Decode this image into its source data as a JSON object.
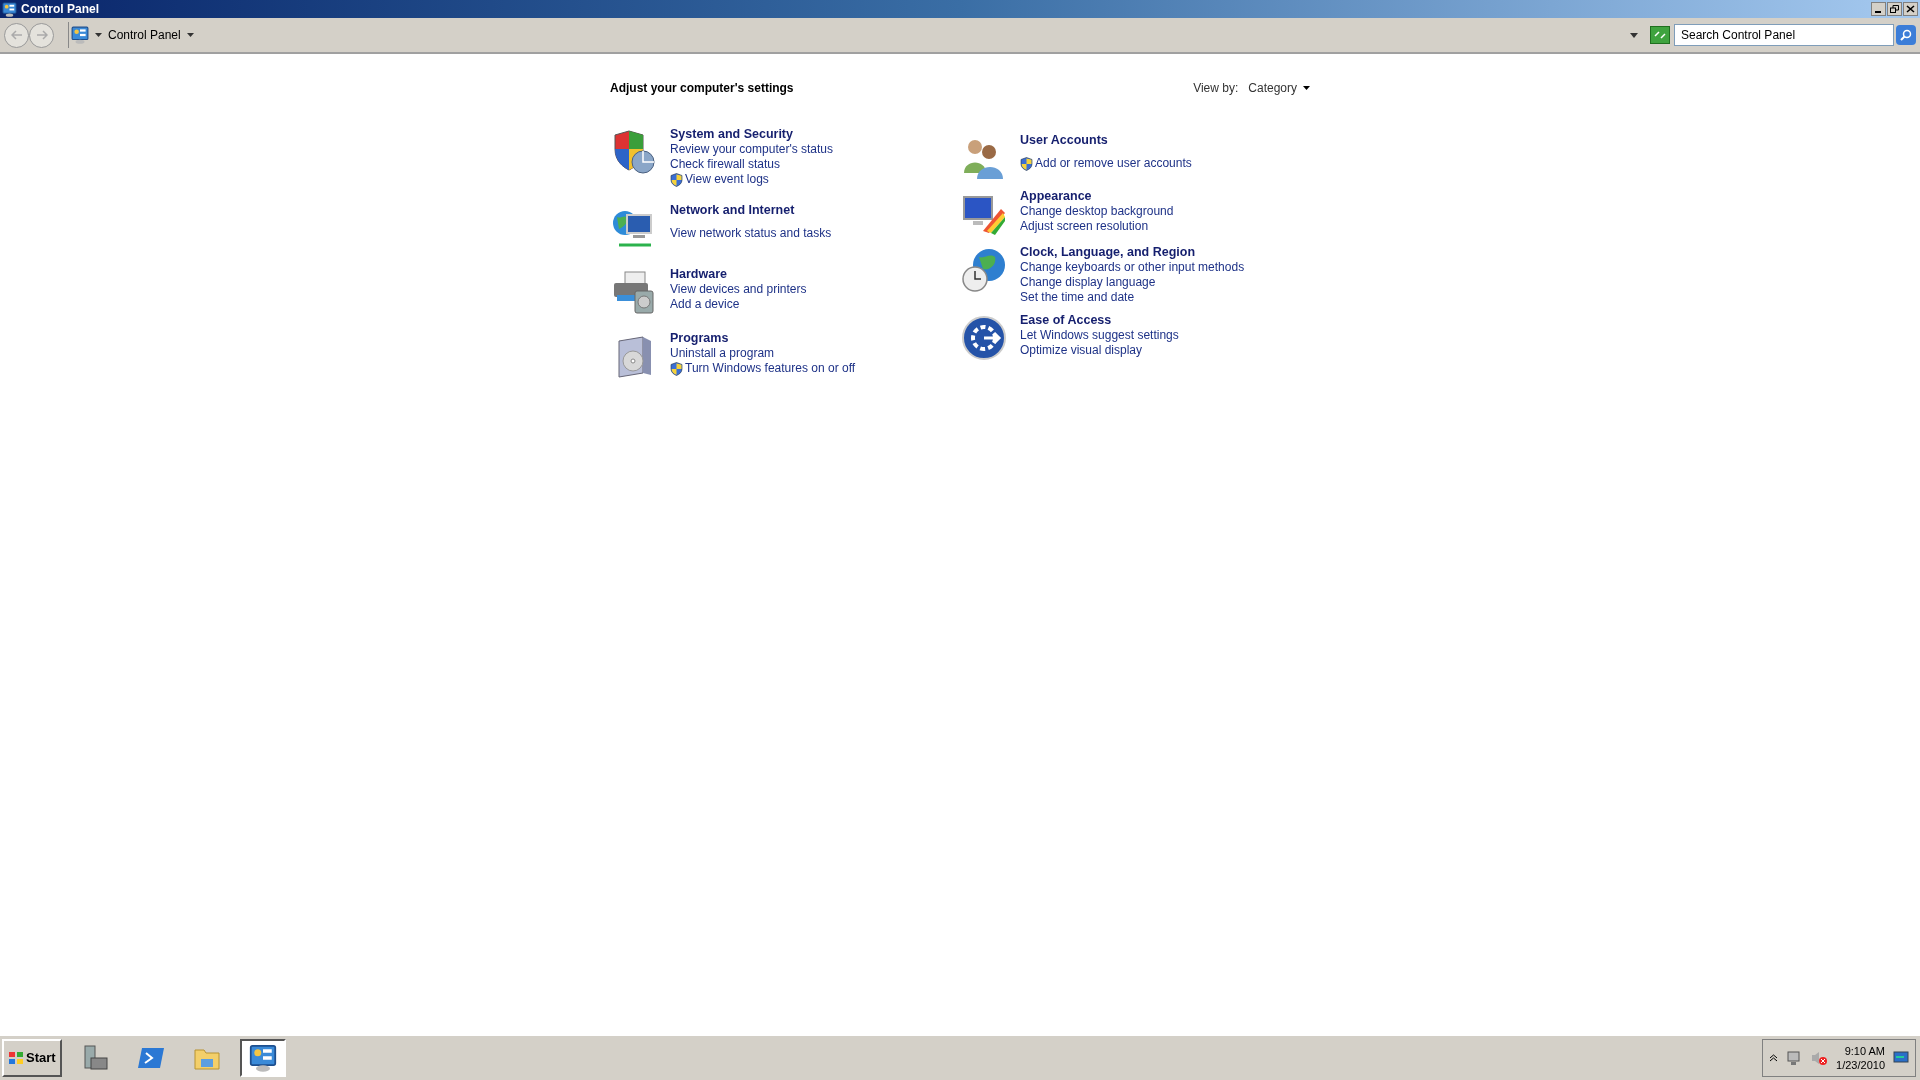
{
  "window": {
    "title": "Control Panel"
  },
  "address_bar": {
    "breadcrumb": "Control Panel"
  },
  "search": {
    "placeholder": "Search Control Panel"
  },
  "heading": "Adjust your computer's settings",
  "view_by": {
    "label": "View by:",
    "value": "Category"
  },
  "columns": [
    {
      "categories": [
        {
          "kind": "security",
          "title": "System and Security",
          "links": [
            {
              "text": "Review your computer's status",
              "shield": false
            },
            {
              "text": "Check firewall status",
              "shield": false
            },
            {
              "text": "View event logs",
              "shield": true
            }
          ]
        },
        {
          "kind": "network",
          "title": "Network and Internet",
          "links": [
            {
              "text": "View network status and tasks",
              "shield": false
            }
          ]
        },
        {
          "kind": "hardware",
          "title": "Hardware",
          "links": [
            {
              "text": "View devices and printers",
              "shield": false
            },
            {
              "text": "Add a device",
              "shield": false
            }
          ]
        },
        {
          "kind": "programs",
          "title": "Programs",
          "links": [
            {
              "text": "Uninstall a program",
              "shield": false
            },
            {
              "text": "Turn Windows features on or off",
              "shield": true
            }
          ]
        }
      ]
    },
    {
      "categories": [
        {
          "kind": "users",
          "title": "User Accounts",
          "links": [
            {
              "text": "Add or remove user accounts",
              "shield": true
            }
          ]
        },
        {
          "kind": "appearance",
          "title": "Appearance",
          "links": [
            {
              "text": "Change desktop background",
              "shield": false
            },
            {
              "text": "Adjust screen resolution",
              "shield": false
            }
          ]
        },
        {
          "kind": "clock",
          "title": "Clock, Language, and Region",
          "links": [
            {
              "text": "Change keyboards or other input methods",
              "shield": false
            },
            {
              "text": "Change display language",
              "shield": false
            },
            {
              "text": "Set the time and date",
              "shield": false
            }
          ]
        },
        {
          "kind": "access",
          "title": "Ease of Access",
          "links": [
            {
              "text": "Let Windows suggest settings",
              "shield": false
            },
            {
              "text": "Optimize visual display",
              "shield": false
            }
          ]
        }
      ]
    }
  ],
  "taskbar": {
    "start": "Start",
    "apps": [
      {
        "kind": "server",
        "selected": false
      },
      {
        "kind": "shell",
        "selected": false
      },
      {
        "kind": "folder",
        "selected": false
      },
      {
        "kind": "panel",
        "selected": true
      }
    ],
    "clock": {
      "time": "9:10 AM",
      "date": "1/23/2010"
    }
  }
}
